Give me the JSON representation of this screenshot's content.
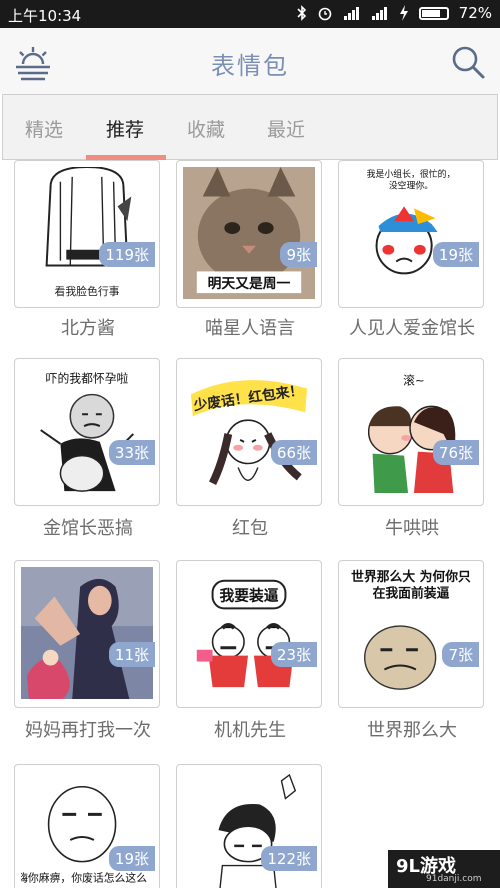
{
  "status_bar": {
    "time": "上午10:34",
    "battery_percent": "72%",
    "battery_level": 0.72,
    "icons": [
      "bluetooth-icon",
      "alarm-icon",
      "signal-icon",
      "signal-icon",
      "charging-icon",
      "battery-icon"
    ]
  },
  "app_bar": {
    "title": "表情包",
    "left_icon": "sunrise-icon",
    "right_icon": "search-icon"
  },
  "tabs": [
    {
      "label": "精选",
      "active": false
    },
    {
      "label": "推荐",
      "active": true
    },
    {
      "label": "收藏",
      "active": false
    },
    {
      "label": "最近",
      "active": false
    }
  ],
  "accent_color": "#f08d7f",
  "badge_color": "#8fa7cf",
  "packs": [
    {
      "name": "北方酱",
      "count": "119张",
      "caption": "看我脸色行事"
    },
    {
      "name": "喵星人语言",
      "count": "9张",
      "caption": "明天又是周一"
    },
    {
      "name": "人见人爱金馆长",
      "count": "19张",
      "caption": "我是小组长，很忙的，没空理你。"
    },
    {
      "name": "金馆长恶搞",
      "count": "33张",
      "caption": "吓的我都怀孕啦"
    },
    {
      "name": "红包",
      "count": "66张",
      "caption": "少废话！红包来！"
    },
    {
      "name": "牛哄哄",
      "count": "76张",
      "caption": "滚~"
    },
    {
      "name": "妈妈再打我一次",
      "count": "11张",
      "caption": ""
    },
    {
      "name": "机机先生",
      "count": "23张",
      "caption": "我要装逼"
    },
    {
      "name": "世界那么大",
      "count": "7张",
      "caption": "世界那么大 为何你只在我面前装逼"
    },
    {
      "name": "",
      "count": "19张",
      "caption": "嗨你麻痹，你废话怎么这么"
    },
    {
      "name": "",
      "count": "122张",
      "caption": ""
    }
  ],
  "watermark": {
    "main": "9L游戏",
    "sub": "91danji.com"
  }
}
